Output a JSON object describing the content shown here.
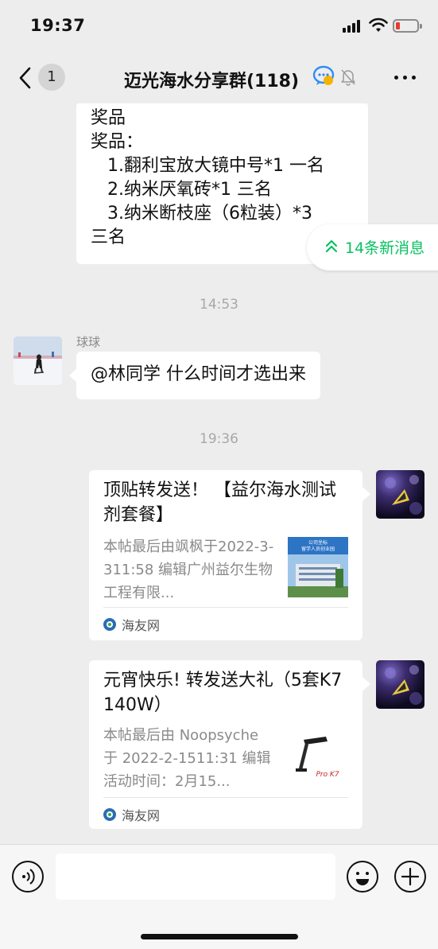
{
  "status_bar": {
    "time": "19:37"
  },
  "header": {
    "unread_count": "1",
    "title": "迈光海水分享群(118)",
    "icons": [
      "chevron-left-icon",
      "chat-bubble-icon",
      "mute-bell-icon",
      "more-dots-icon"
    ]
  },
  "new_messages": {
    "label": "14条新消息"
  },
  "messages": {
    "prize": {
      "lines": [
        "奖品",
        "奖品：",
        "   1.翻利宝放大镜中号*1 一名",
        "   2.纳米厌氧砖*1 三名",
        "   3.纳米断枝座（6粒装）*3",
        "三名"
      ]
    },
    "time1": "14:53",
    "qiuqiu": {
      "sender": "球球",
      "text": "@林同学 什么时间才选出来"
    },
    "time2": "19:36",
    "card1": {
      "title": "顶贴转发送！ 【益尔海水测试剂套餐】",
      "desc": "本帖最后由飒枫于2022-3-311:58 编辑广州益尔生物工程有限...",
      "source": "海友网",
      "thumb_text1": "公司坐标",
      "thumb_text2": "留学人员创业园"
    },
    "card2": {
      "title": "元宵快乐! 转发送大礼（5套K7  140W）",
      "desc": "本帖最后由 Noopsyche 于 2022-2-1511:31 编辑活动时间：2月15...",
      "source": "海友网",
      "thumb_text": "Pro K7"
    }
  },
  "colors": {
    "accent_green": "#07c160",
    "background": "#ededed",
    "bubble": "#ffffff"
  }
}
